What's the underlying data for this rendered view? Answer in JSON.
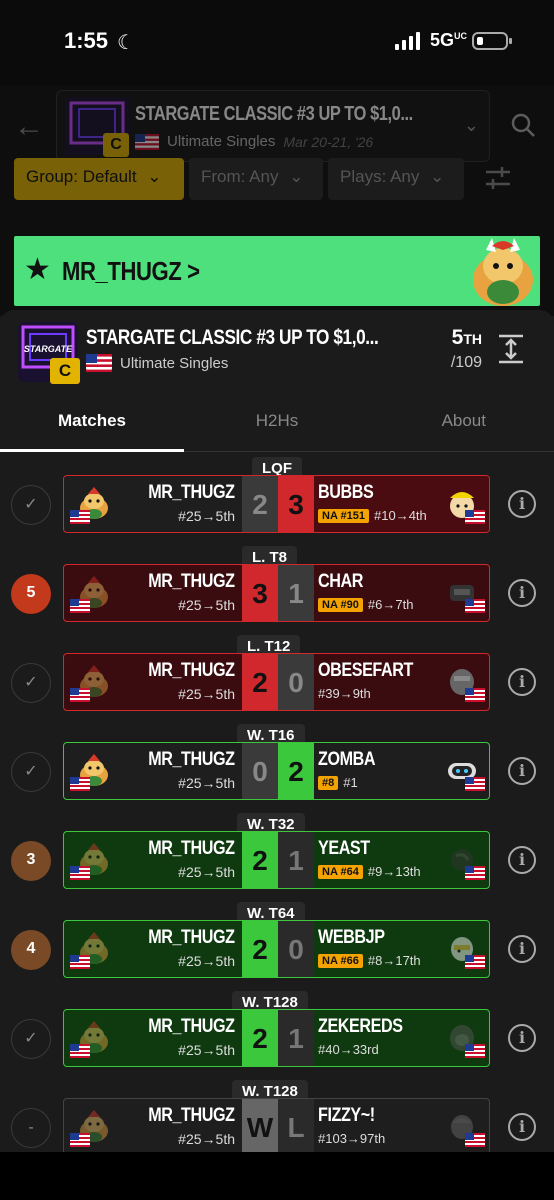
{
  "status_bar": {
    "time": "1:55",
    "moon": "☾",
    "network": "5G",
    "network_sup": "UC"
  },
  "event": {
    "title": "STARGATE CLASSIC #3 UP TO $1,0...",
    "tier": "C",
    "game": "Ultimate Singles",
    "dates": "Mar 20-21, '26",
    "logo_text": "STARGATE"
  },
  "filters": {
    "group": "Group: Default",
    "from": "From: Any",
    "plays": "Plays: Any"
  },
  "player": {
    "name": "MR_THUGZ",
    "chevron": ">"
  },
  "sheet": {
    "title": "STARGATE CLASSIC #3 UP TO $1,0...",
    "tier": "C",
    "game": "Ultimate Singles",
    "placing": "5",
    "placing_suffix": "TH",
    "entrants": "/109"
  },
  "tabs": [
    "Matches",
    "H2Hs",
    "About"
  ],
  "colors": {
    "win": "#3cc83c",
    "loss": "#d0282c",
    "accent": "#e2b400",
    "banner": "#4ee07c",
    "na_tag": "#f4a300"
  },
  "matches": [
    {
      "round": "LQF",
      "side": "✓",
      "left_name": "MR_THUGZ",
      "left_seed": "#25→5th",
      "score_left": "2",
      "score_right": "3",
      "right_name": "BUBBS",
      "right_tag": "NA #151",
      "right_seed": "#10→4th",
      "result": "loss"
    },
    {
      "round": "L. T8",
      "side": "5",
      "side_color": "#c2391b",
      "left_name": "MR_THUGZ",
      "left_seed": "#25→5th",
      "score_left": "3",
      "score_right": "1",
      "right_name": "CHAR",
      "right_tag": "NA #90",
      "right_seed": "#6→7th",
      "result": "upset_loss"
    },
    {
      "round": "L. T12",
      "side": "✓",
      "left_name": "MR_THUGZ",
      "left_seed": "#25→5th",
      "score_left": "2",
      "score_right": "0",
      "right_name": "OBESEFART",
      "right_tag": "",
      "right_seed": "#39→9th",
      "result": "upset_loss"
    },
    {
      "round": "W. T16",
      "side": "✓",
      "left_name": "MR_THUGZ",
      "left_seed": "#25→5th",
      "score_left": "0",
      "score_right": "2",
      "right_name": "ZOMBA",
      "right_tag": "#8",
      "right_seed": "#1",
      "result": "opp_win"
    },
    {
      "round": "W. T32",
      "side": "3",
      "side_color": "#7a4a26",
      "left_name": "MR_THUGZ",
      "left_seed": "#25→5th",
      "score_left": "2",
      "score_right": "1",
      "right_name": "YEAST",
      "right_tag": "NA #64",
      "right_seed": "#9→13th",
      "result": "win"
    },
    {
      "round": "W. T64",
      "side": "4",
      "side_color": "#7a4a26",
      "left_name": "MR_THUGZ",
      "left_seed": "#25→5th",
      "score_left": "2",
      "score_right": "0",
      "right_name": "WEBBJP",
      "right_tag": "NA #66",
      "right_seed": "#8→17th",
      "result": "win"
    },
    {
      "round": "W. T128",
      "side": "✓",
      "left_name": "MR_THUGZ",
      "left_seed": "#25→5th",
      "score_left": "2",
      "score_right": "1",
      "right_name": "ZEKEREDS",
      "right_tag": "",
      "right_seed": "#40→33rd",
      "result": "win"
    },
    {
      "round": "W. T128",
      "side": "-",
      "left_name": "MR_THUGZ",
      "left_seed": "#25→5th",
      "score_left": "W",
      "score_right": "L",
      "right_name": "FIZZY~!",
      "right_tag": "",
      "right_seed": "#103→97th",
      "result": "dq"
    }
  ]
}
